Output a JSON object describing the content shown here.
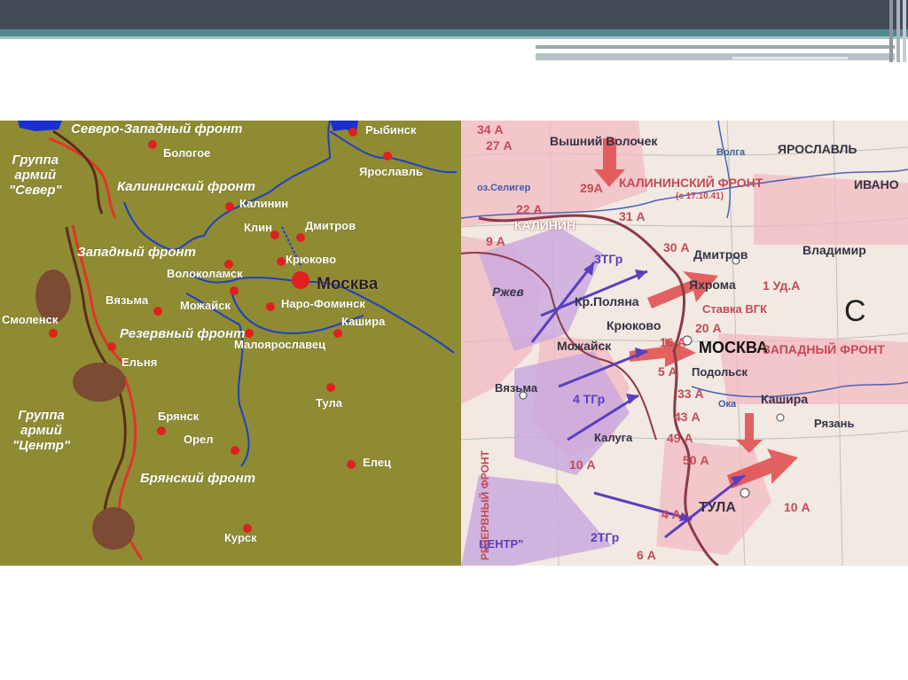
{
  "left_map": {
    "fronts": [
      "Северо-Западный фронт",
      "Калининский фронт",
      "Западный фронт",
      "Резервный фронт",
      "Брянский фронт"
    ],
    "army_groups": [
      {
        "line1": "Группа",
        "line2": "армий",
        "line3": "\"Север\""
      },
      {
        "line1": "Группа",
        "line2": "армий",
        "line3": "\"Центр\""
      }
    ],
    "cities": {
      "rybinsk": "Рыбинск",
      "bologoe": "Бологое",
      "yaroslavl": "Ярославль",
      "kalinin": "Калинин",
      "klin": "Клин",
      "dmitrov": "Дмитров",
      "kryukovo": "Крюково",
      "volokolamsk": "Волоколамск",
      "moskva": "Москва",
      "vyazma": "Вязьма",
      "mozhaysk": "Можайск",
      "naro_fominsk": "Наро-Фоминск",
      "smolensk": "Смоленск",
      "kashira": "Кашира",
      "maloyaroslavets": "Малоярославец",
      "yelnya": "Ельня",
      "tula": "Тула",
      "bryansk": "Брянск",
      "orel": "Орел",
      "yelets": "Елец",
      "kursk": "Курск"
    }
  },
  "right_map": {
    "labels": {
      "vyshniy_volochek": "Вышний Волочек",
      "yaroslavl": "ЯРОСЛАВЛЬ",
      "ivanovo": "ИВАНО",
      "kalinin_front": "КАЛИНИНСКИЙ ФРОНТ",
      "front_date": "(с 17.10.41)",
      "kalinin": "КАЛИНИН",
      "dmitrov": "Дмитров",
      "vladimir": "Владимир",
      "rzhev": "Ржев",
      "kr_polyana": "Кр.Поляна",
      "yakhroma": "Яхрома",
      "stavka": "Ставка ВГК",
      "kryukovo": "Крюково",
      "mozhaysk": "Можайск",
      "moskva": "МОСКВА",
      "western_front": "ЗАПАДНЫЙ ФРОНТ",
      "podolsk": "Подольск",
      "vyazma": "Вязьма",
      "kashira": "Кашира",
      "oka": "Ока",
      "ryazan": "Рязань",
      "kaluga": "Калуга",
      "tula": "ТУЛА",
      "seliger": "оз.Селигер",
      "volga": "Волга",
      "centr": "ЦЕНТР\"",
      "reserve_front": "РЕЗЕРВНЫЙ ФРОНТ",
      "c_mark": "С"
    },
    "army_labels": [
      "34 А",
      "27 А",
      "29А",
      "22 А",
      "31 А",
      "9 А",
      "3ТГр",
      "30 А",
      "1 Уд.А",
      "20 А",
      "16 А",
      "5 А",
      "33 А",
      "43 А",
      "49 А",
      "4 ТГр",
      "50 А",
      "10 А",
      "4 А",
      "10 А",
      "2ТГр",
      "6 А"
    ]
  },
  "colors": {
    "topbar": "#444a57",
    "teal_line": "#4f8a8f",
    "left_map_bg": "#8e8b33",
    "right_map_bg": "#f2e9e2",
    "front_line_red": "#e2332b",
    "river_blue": "#1f3fc4",
    "city_marker": "#e02020",
    "marsh_brown": "#7d4a34"
  }
}
